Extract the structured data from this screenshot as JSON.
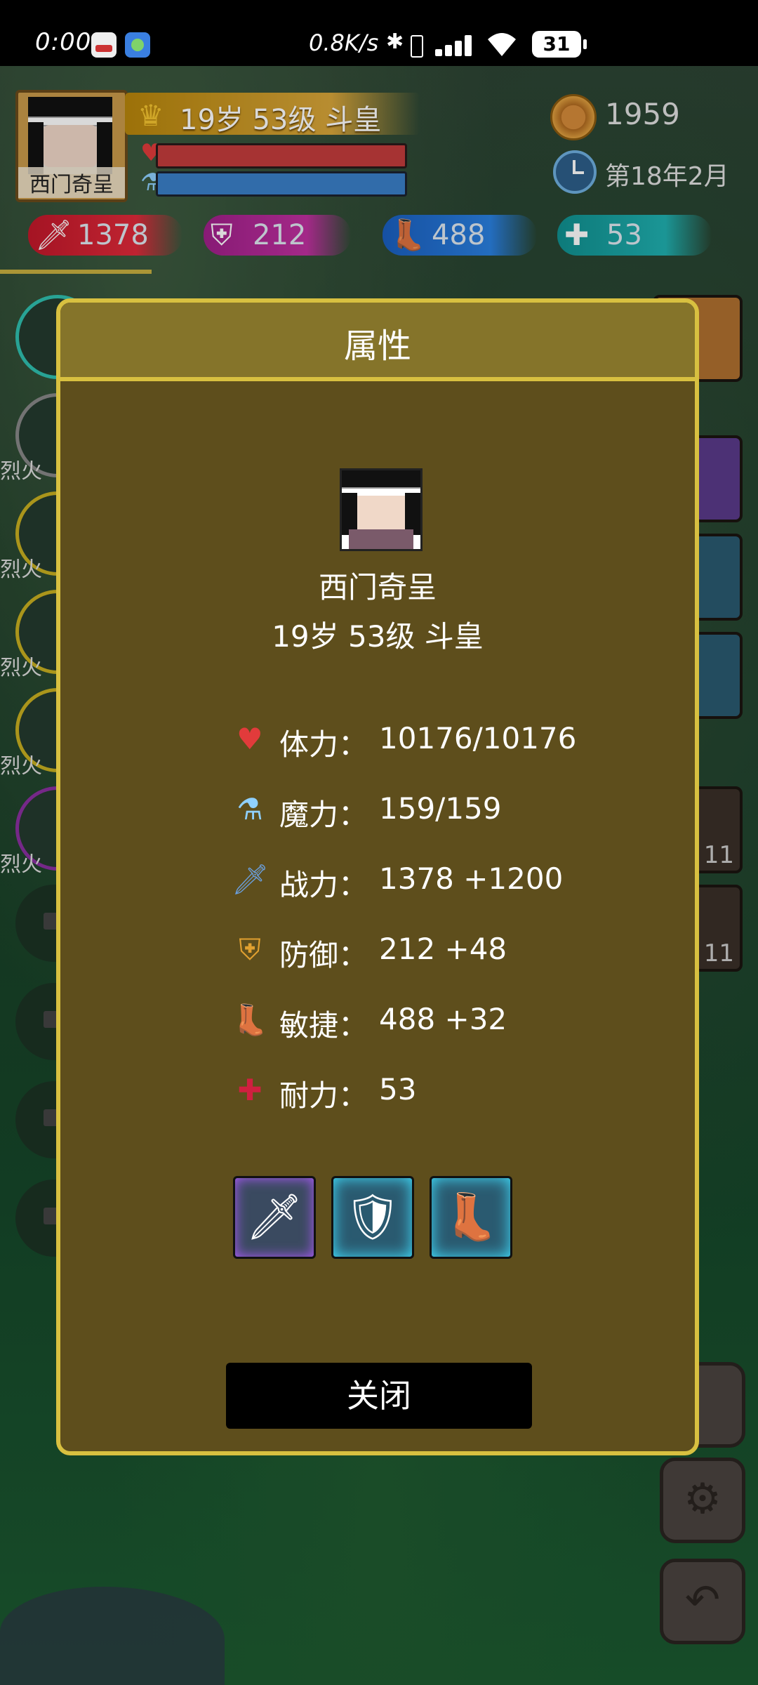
{
  "status_bar": {
    "time": "0:00",
    "speed": "0.8K/s",
    "battery": "31"
  },
  "hero": {
    "name": "西门奇呈",
    "level_text": "19岁 53级 斗皇",
    "gold": "1959",
    "date": "第18年2月"
  },
  "stats_bar": {
    "attack": "1378",
    "defense": "212",
    "agility": "488",
    "endurance": "53"
  },
  "background": {
    "skill_labels": [
      "烈火",
      "烈火",
      "烈火",
      "烈火",
      "烈火"
    ],
    "item_counts": [
      "11",
      "11"
    ]
  },
  "modal": {
    "title": "属性",
    "name": "西门奇呈",
    "level_text": "19岁 53级 斗皇",
    "attributes": [
      {
        "icon": "heart-icon",
        "label": "体力：",
        "value": "10176/10176"
      },
      {
        "icon": "mana-potion-icon",
        "label": "魔力：",
        "value": "159/159"
      },
      {
        "icon": "sword-icon",
        "label": "战力：",
        "value": "1378 +1200"
      },
      {
        "icon": "shield-icon",
        "label": "防御：",
        "value": "212 +48"
      },
      {
        "icon": "boot-icon",
        "label": "敏捷：",
        "value": "488 +32"
      },
      {
        "icon": "health-cross-icon",
        "label": "耐力：",
        "value": "53"
      }
    ],
    "equipment": [
      "sword-icon",
      "armor-icon",
      "boots-icon"
    ],
    "close_label": "关闭"
  },
  "colors": {
    "modal_bg": "#5e4e1c",
    "modal_border": "#d8c040",
    "header_bg": "#85742a"
  }
}
